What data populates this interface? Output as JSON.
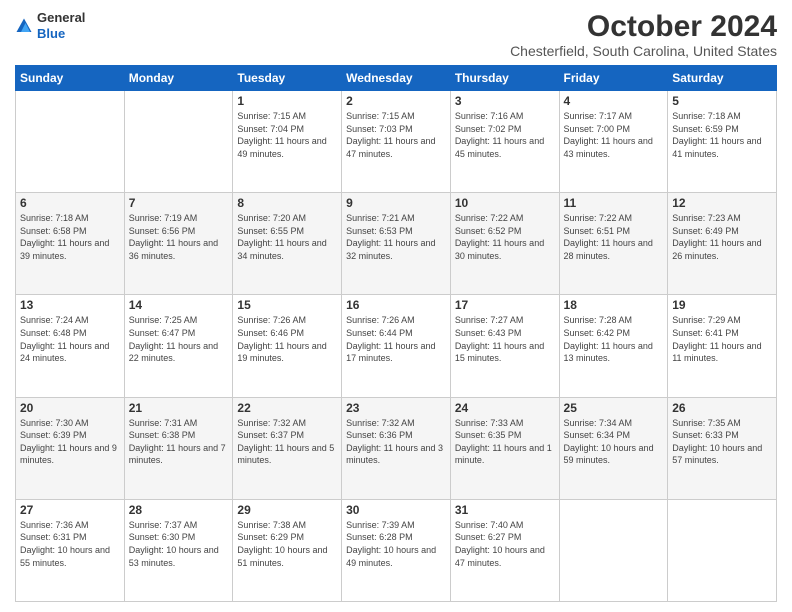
{
  "logo": {
    "general": "General",
    "blue": "Blue"
  },
  "header": {
    "title": "October 2024",
    "subtitle": "Chesterfield, South Carolina, United States"
  },
  "weekdays": [
    "Sunday",
    "Monday",
    "Tuesday",
    "Wednesday",
    "Thursday",
    "Friday",
    "Saturday"
  ],
  "weeks": [
    [
      {
        "day": "",
        "info": ""
      },
      {
        "day": "",
        "info": ""
      },
      {
        "day": "1",
        "info": "Sunrise: 7:15 AM\nSunset: 7:04 PM\nDaylight: 11 hours and 49 minutes."
      },
      {
        "day": "2",
        "info": "Sunrise: 7:15 AM\nSunset: 7:03 PM\nDaylight: 11 hours and 47 minutes."
      },
      {
        "day": "3",
        "info": "Sunrise: 7:16 AM\nSunset: 7:02 PM\nDaylight: 11 hours and 45 minutes."
      },
      {
        "day": "4",
        "info": "Sunrise: 7:17 AM\nSunset: 7:00 PM\nDaylight: 11 hours and 43 minutes."
      },
      {
        "day": "5",
        "info": "Sunrise: 7:18 AM\nSunset: 6:59 PM\nDaylight: 11 hours and 41 minutes."
      }
    ],
    [
      {
        "day": "6",
        "info": "Sunrise: 7:18 AM\nSunset: 6:58 PM\nDaylight: 11 hours and 39 minutes."
      },
      {
        "day": "7",
        "info": "Sunrise: 7:19 AM\nSunset: 6:56 PM\nDaylight: 11 hours and 36 minutes."
      },
      {
        "day": "8",
        "info": "Sunrise: 7:20 AM\nSunset: 6:55 PM\nDaylight: 11 hours and 34 minutes."
      },
      {
        "day": "9",
        "info": "Sunrise: 7:21 AM\nSunset: 6:53 PM\nDaylight: 11 hours and 32 minutes."
      },
      {
        "day": "10",
        "info": "Sunrise: 7:22 AM\nSunset: 6:52 PM\nDaylight: 11 hours and 30 minutes."
      },
      {
        "day": "11",
        "info": "Sunrise: 7:22 AM\nSunset: 6:51 PM\nDaylight: 11 hours and 28 minutes."
      },
      {
        "day": "12",
        "info": "Sunrise: 7:23 AM\nSunset: 6:49 PM\nDaylight: 11 hours and 26 minutes."
      }
    ],
    [
      {
        "day": "13",
        "info": "Sunrise: 7:24 AM\nSunset: 6:48 PM\nDaylight: 11 hours and 24 minutes."
      },
      {
        "day": "14",
        "info": "Sunrise: 7:25 AM\nSunset: 6:47 PM\nDaylight: 11 hours and 22 minutes."
      },
      {
        "day": "15",
        "info": "Sunrise: 7:26 AM\nSunset: 6:46 PM\nDaylight: 11 hours and 19 minutes."
      },
      {
        "day": "16",
        "info": "Sunrise: 7:26 AM\nSunset: 6:44 PM\nDaylight: 11 hours and 17 minutes."
      },
      {
        "day": "17",
        "info": "Sunrise: 7:27 AM\nSunset: 6:43 PM\nDaylight: 11 hours and 15 minutes."
      },
      {
        "day": "18",
        "info": "Sunrise: 7:28 AM\nSunset: 6:42 PM\nDaylight: 11 hours and 13 minutes."
      },
      {
        "day": "19",
        "info": "Sunrise: 7:29 AM\nSunset: 6:41 PM\nDaylight: 11 hours and 11 minutes."
      }
    ],
    [
      {
        "day": "20",
        "info": "Sunrise: 7:30 AM\nSunset: 6:39 PM\nDaylight: 11 hours and 9 minutes."
      },
      {
        "day": "21",
        "info": "Sunrise: 7:31 AM\nSunset: 6:38 PM\nDaylight: 11 hours and 7 minutes."
      },
      {
        "day": "22",
        "info": "Sunrise: 7:32 AM\nSunset: 6:37 PM\nDaylight: 11 hours and 5 minutes."
      },
      {
        "day": "23",
        "info": "Sunrise: 7:32 AM\nSunset: 6:36 PM\nDaylight: 11 hours and 3 minutes."
      },
      {
        "day": "24",
        "info": "Sunrise: 7:33 AM\nSunset: 6:35 PM\nDaylight: 11 hours and 1 minute."
      },
      {
        "day": "25",
        "info": "Sunrise: 7:34 AM\nSunset: 6:34 PM\nDaylight: 10 hours and 59 minutes."
      },
      {
        "day": "26",
        "info": "Sunrise: 7:35 AM\nSunset: 6:33 PM\nDaylight: 10 hours and 57 minutes."
      }
    ],
    [
      {
        "day": "27",
        "info": "Sunrise: 7:36 AM\nSunset: 6:31 PM\nDaylight: 10 hours and 55 minutes."
      },
      {
        "day": "28",
        "info": "Sunrise: 7:37 AM\nSunset: 6:30 PM\nDaylight: 10 hours and 53 minutes."
      },
      {
        "day": "29",
        "info": "Sunrise: 7:38 AM\nSunset: 6:29 PM\nDaylight: 10 hours and 51 minutes."
      },
      {
        "day": "30",
        "info": "Sunrise: 7:39 AM\nSunset: 6:28 PM\nDaylight: 10 hours and 49 minutes."
      },
      {
        "day": "31",
        "info": "Sunrise: 7:40 AM\nSunset: 6:27 PM\nDaylight: 10 hours and 47 minutes."
      },
      {
        "day": "",
        "info": ""
      },
      {
        "day": "",
        "info": ""
      }
    ]
  ]
}
